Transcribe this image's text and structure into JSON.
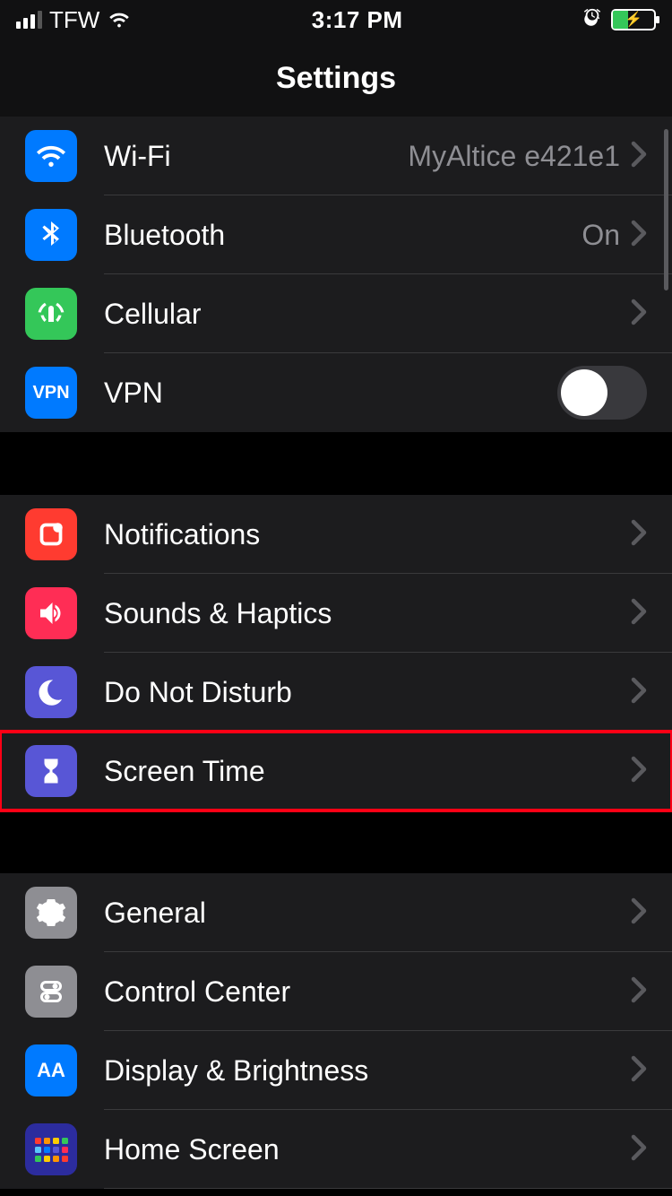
{
  "statusBar": {
    "carrier": "TFW",
    "time": "3:17 PM"
  },
  "header": {
    "title": "Settings"
  },
  "groups": [
    {
      "rows": [
        {
          "label": "Wi-Fi",
          "value": "MyAltice e421e1"
        },
        {
          "label": "Bluetooth",
          "value": "On"
        },
        {
          "label": "Cellular"
        },
        {
          "label": "VPN",
          "toggleOn": false,
          "iconText": "VPN"
        }
      ]
    },
    {
      "rows": [
        {
          "label": "Notifications"
        },
        {
          "label": "Sounds & Haptics"
        },
        {
          "label": "Do Not Disturb"
        },
        {
          "label": "Screen Time",
          "highlighted": true
        }
      ]
    },
    {
      "rows": [
        {
          "label": "General"
        },
        {
          "label": "Control Center"
        },
        {
          "label": "Display & Brightness",
          "iconText": "AA"
        },
        {
          "label": "Home Screen"
        }
      ]
    }
  ]
}
